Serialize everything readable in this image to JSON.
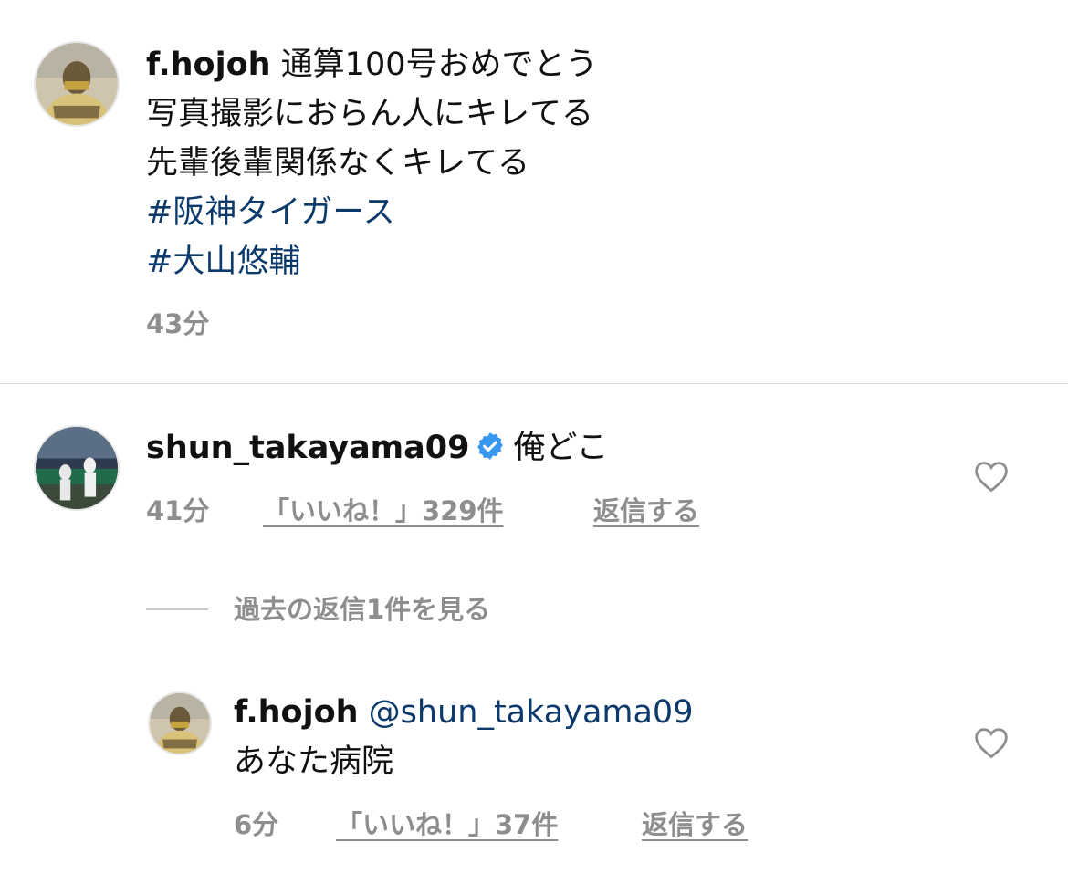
{
  "post": {
    "username": "f.hojoh",
    "caption_first": "通算100号おめでとう",
    "caption_line2": "写真撮影におらん人にキレてる",
    "caption_line3": "先輩後輩関係なくキレてる",
    "hashtag1": "#阪神タイガース",
    "hashtag2": "#大山悠輔",
    "time": "43分"
  },
  "comment": {
    "username": "shun_takayama09",
    "verified": true,
    "text": "俺どこ",
    "time": "41分",
    "likes": "「いいね！」329件",
    "reply_label": "返信する",
    "view_replies": "過去の返信1件を見る"
  },
  "reply": {
    "username": "f.hojoh",
    "mention": "@shun_takayama09",
    "text": "あなた病院",
    "time": "6分",
    "likes": "「いいね！」37件",
    "reply_label": "返信する"
  },
  "icons": {
    "heart": "heart-outline-icon",
    "verified": "verified-badge-icon"
  },
  "colors": {
    "hashtag": "#0b3a6b",
    "verified": "#3897f0",
    "meta": "#8e8e8e"
  }
}
